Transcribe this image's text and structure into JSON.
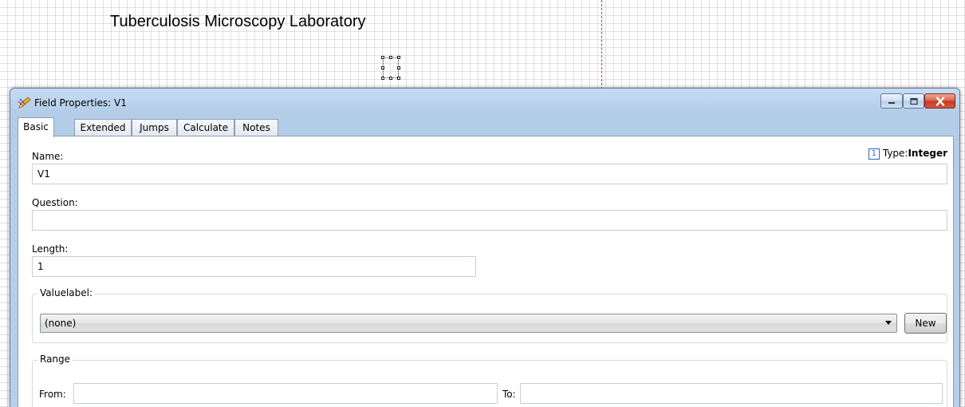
{
  "canvas": {
    "heading": "Tuberculosis Microscopy Laboratory"
  },
  "window": {
    "title": "Field Properties: V1",
    "icon": "pencil-field-icon",
    "controls": [
      "minimize-icon",
      "maximize-icon",
      "close-icon"
    ]
  },
  "tabs": [
    {
      "label": "Basic",
      "active": true
    },
    {
      "label": "Extended",
      "active": false
    },
    {
      "label": "Jumps",
      "active": false
    },
    {
      "label": "Calculate",
      "active": false
    },
    {
      "label": "Notes",
      "active": false
    }
  ],
  "basic": {
    "name_label": "Name:",
    "name_value": "V1",
    "type_badge": "1",
    "type_label": "Type:",
    "type_value": "Integer",
    "question_label": "Question:",
    "question_value": "",
    "length_label": "Length:",
    "length_value": "1",
    "valuelabel": {
      "group_title": "Valuelabel:",
      "selected": "(none)",
      "new_button": "New"
    },
    "range": {
      "group_title": "Range",
      "from_label": "From:",
      "from_value": "",
      "to_label": "To:",
      "to_value": ""
    }
  },
  "colors": {
    "title_bar": "#b3cde8",
    "close_button": "#c2391f",
    "type_badge": "#2a68c4",
    "guide_line": "#e03030"
  }
}
